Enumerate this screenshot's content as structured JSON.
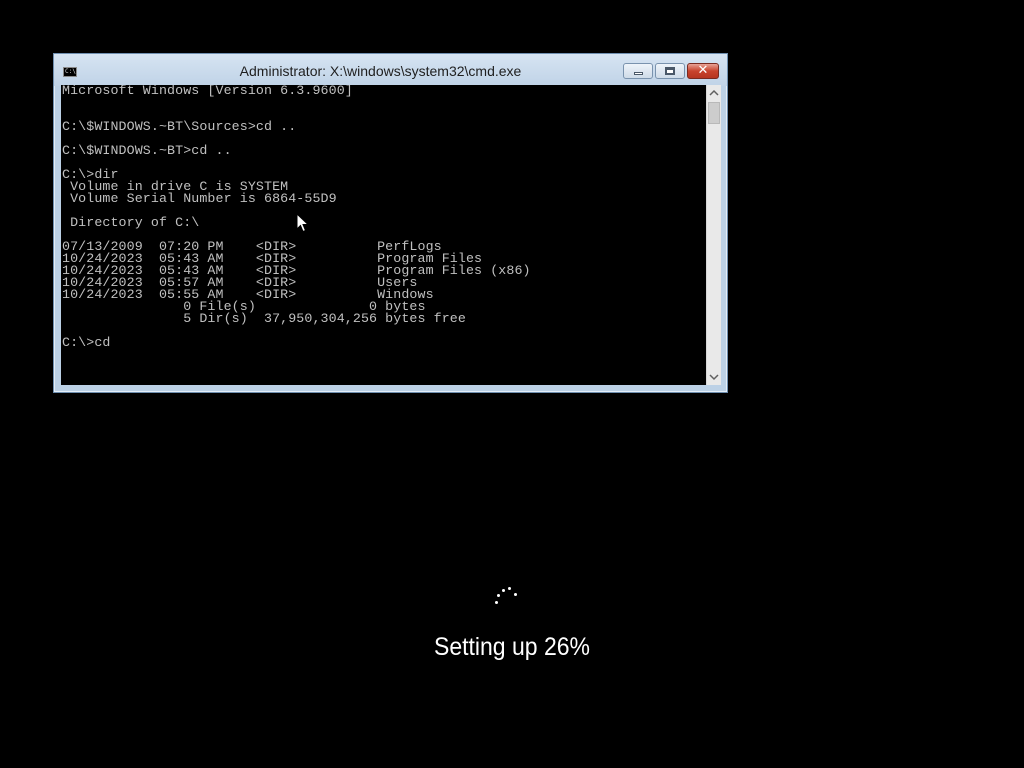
{
  "window": {
    "title": "Administrator: X:\\windows\\system32\\cmd.exe",
    "icon": "cmd-icon",
    "icon_text": "C:\\",
    "buttons": {
      "minimize": "minimize-icon",
      "maximize": "maximize-icon",
      "close": "close-icon",
      "close_glyph": "✕"
    }
  },
  "console": {
    "lines": [
      "Microsoft Windows [Version 6.3.9600]",
      "",
      "",
      "C:\\$WINDOWS.~BT\\Sources>cd ..",
      "",
      "C:\\$WINDOWS.~BT>cd ..",
      "",
      "C:\\>dir",
      " Volume in drive C is SYSTEM",
      " Volume Serial Number is 6864-55D9",
      "",
      " Directory of C:\\",
      "",
      "07/13/2009  07:20 PM    <DIR>          PerfLogs",
      "10/24/2023  05:43 AM    <DIR>          Program Files",
      "10/24/2023  05:43 AM    <DIR>          Program Files (x86)",
      "10/24/2023  05:57 AM    <DIR>          Users",
      "10/24/2023  05:55 AM    <DIR>          Windows",
      "               0 File(s)              0 bytes",
      "               5 Dir(s)  37,950,304,256 bytes free",
      "",
      "C:\\>cd"
    ]
  },
  "scrollbar": {
    "up_glyph": "^",
    "down_glyph": "v"
  },
  "setup": {
    "status": "Setting up 26%",
    "progress_percent": 26
  },
  "colors": {
    "desktop_bg": "#000000",
    "console_bg": "#000000",
    "console_text": "#c0c0c0",
    "window_frame": "#bcd1e6",
    "close_button": "#c8432d"
  }
}
